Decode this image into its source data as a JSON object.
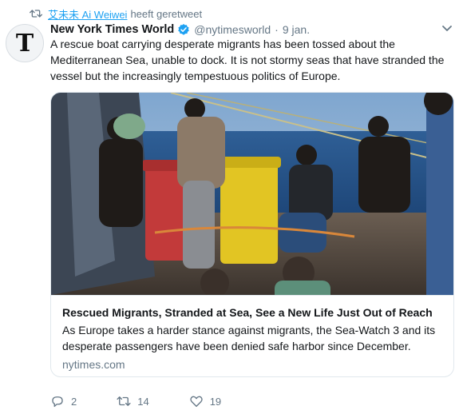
{
  "retweet": {
    "user": "艾未未 Ai Weiwei",
    "suffix": "heeft geretweet"
  },
  "tweet": {
    "author_name": "New York Times World",
    "handle": "@nytimesworld",
    "separator": "·",
    "date": "9 jan.",
    "avatar_glyph": "T",
    "text": "A rescue boat carrying desperate migrants has been tossed about the Mediterranean Sea, unable to dock. It is not stormy seas that have stranded the vessel but the increasingly tempestuous politics of Europe."
  },
  "card": {
    "title": "Rescued Migrants, Stranded at Sea, See a New Life Just Out of Reach",
    "description": "As Europe takes a harder stance against migrants, the Sea-Watch 3 and its desperate passengers have been denied safe harbor since December.",
    "domain": "nytimes.com"
  },
  "actions": {
    "replies": "2",
    "retweets": "14",
    "likes": "19"
  },
  "colors": {
    "link": "#1da1f2",
    "muted": "#657786",
    "verified": "#1da1f2",
    "border": "#e1e8ed"
  },
  "icons": [
    "retweet-icon",
    "verified-icon",
    "chevron-down-icon",
    "reply-icon",
    "like-icon"
  ]
}
